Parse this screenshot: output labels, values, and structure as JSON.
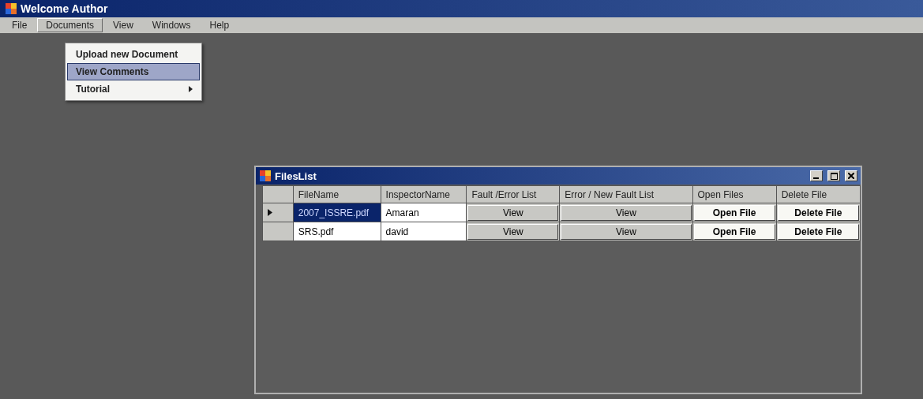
{
  "window": {
    "title": "Welcome Author"
  },
  "menu_bar": [
    {
      "label": "File",
      "selected": false
    },
    {
      "label": "Documents",
      "selected": true
    },
    {
      "label": "View",
      "selected": false
    },
    {
      "label": "Windows",
      "selected": false
    },
    {
      "label": "Help",
      "selected": false
    }
  ],
  "dropdown": [
    {
      "label": "Upload new Document",
      "selected": false,
      "submenu": false
    },
    {
      "label": "View Comments",
      "selected": true,
      "submenu": false
    },
    {
      "label": "Tutorial",
      "selected": false,
      "submenu": true
    }
  ],
  "child_window": {
    "title": "FilesList",
    "table": {
      "columns": [
        "FileName",
        "InspectorName",
        "Fault /Error List",
        "Error / New Fault List",
        "Open Files",
        "Delete File"
      ],
      "rows": [
        {
          "current": true,
          "selected": true,
          "cells": [
            "2007_ISSRE.pdf",
            "Amaran",
            "View",
            "View",
            "Open File",
            "Delete File"
          ]
        },
        {
          "current": false,
          "selected": false,
          "cells": [
            "SRS.pdf",
            "david",
            "View",
            "View",
            "Open File",
            "Delete File"
          ]
        }
      ]
    }
  }
}
